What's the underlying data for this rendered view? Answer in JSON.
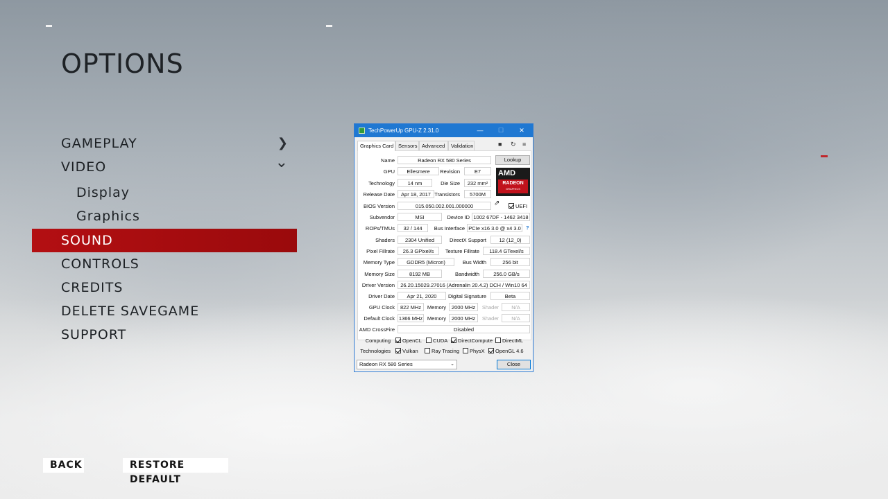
{
  "game": {
    "title": "OPTIONS",
    "menu": [
      {
        "label": "GAMEPLAY",
        "arrow": "❯"
      },
      {
        "label": "VIDEO",
        "arrow": "⌄"
      },
      {
        "label": "Display"
      },
      {
        "label": "Graphics"
      },
      {
        "label": "SOUND"
      },
      {
        "label": "CONTROLS"
      },
      {
        "label": "CREDITS"
      },
      {
        "label": "DELETE SAVEGAME"
      },
      {
        "label": "SUPPORT"
      }
    ],
    "back_label": "BACK",
    "restore_label": "RESTORE DEFAULT",
    "accent_color": "#b30f12"
  },
  "gpuz": {
    "window_title": "TechPowerUp GPU-Z 2.31.0",
    "window_buttons": {
      "minimize": "—",
      "maximize": "☐",
      "close": "✕"
    },
    "tabs": [
      "Graphics Card",
      "Sensors",
      "Advanced",
      "Validation"
    ],
    "tool_icons": {
      "camera": "camera-icon",
      "refresh": "refresh-icon",
      "menu": "menu-icon"
    },
    "lookup_label": "Lookup",
    "logo": {
      "brand": "AMD",
      "line1": "RADEON",
      "line2": "GRAPHICS"
    },
    "fields": {
      "name_label": "Name",
      "name": "Radeon RX 580 Series",
      "gpu_label": "GPU",
      "gpu": "Ellesmere",
      "revision_label": "Revision",
      "revision": "E7",
      "technology_label": "Technology",
      "technology": "14 nm",
      "die_size_label": "Die Size",
      "die_size": "232 mm²",
      "release_date_label": "Release Date",
      "release_date": "Apr 18, 2017",
      "transistors_label": "Transistors",
      "transistors": "5700M",
      "bios_label": "BIOS Version",
      "bios": "015.050.002.001.000000",
      "uefi_label": "UEFI",
      "subvendor_label": "Subvendor",
      "subvendor": "MSI",
      "device_id_label": "Device ID",
      "device_id": "1002 67DF - 1462 3418",
      "rops_label": "ROPs/TMUs",
      "rops": "32 / 144",
      "bus_interface_label": "Bus Interface",
      "bus_interface": "PCIe x16 3.0 @ x4 3.0",
      "help": "?",
      "shaders_label": "Shaders",
      "shaders": "2304 Unified",
      "directx_label": "DirectX Support",
      "directx": "12 (12_0)",
      "pixel_fillrate_label": "Pixel Fillrate",
      "pixel_fillrate": "26.3 GPixel/s",
      "texture_fillrate_label": "Texture Fillrate",
      "texture_fillrate": "118.4 GTexel/s",
      "memory_type_label": "Memory Type",
      "memory_type": "GDDR5 (Micron)",
      "bus_width_label": "Bus Width",
      "bus_width": "256 bit",
      "memory_size_label": "Memory Size",
      "memory_size": "8192 MB",
      "bandwidth_label": "Bandwidth",
      "bandwidth": "256.0 GB/s",
      "driver_version_label": "Driver Version",
      "driver_version": "26.20.15029.27016 (Adrenalin 20.4.2) DCH / Win10 64",
      "driver_date_label": "Driver Date",
      "driver_date": "Apr 21, 2020",
      "digital_signature_label": "Digital Signature",
      "digital_signature": "Beta",
      "gpu_clock_label": "GPU Clock",
      "gpu_clock": "822 MHz",
      "memory_label": "Memory",
      "gpu_clock_memory": "2000 MHz",
      "shader_label": "Shader",
      "na": "N/A",
      "default_clock_label": "Default Clock",
      "default_clock": "1366 MHz",
      "default_clock_memory": "2000 MHz",
      "crossfire_label": "AMD CrossFire",
      "crossfire": "Disabled",
      "computing_label": "Computing",
      "technologies_label": "Technologies"
    },
    "computing": [
      {
        "label": "OpenCL",
        "checked": true
      },
      {
        "label": "CUDA",
        "checked": false
      },
      {
        "label": "DirectCompute",
        "checked": true
      },
      {
        "label": "DirectML",
        "checked": false
      }
    ],
    "technologies": [
      {
        "label": "Vulkan",
        "checked": true
      },
      {
        "label": "Ray Tracing",
        "checked": false
      },
      {
        "label": "PhysX",
        "checked": false
      },
      {
        "label": "OpenGL 4.6",
        "checked": true
      }
    ],
    "selected_gpu": "Radeon RX 580 Series",
    "close_label": "Close",
    "title_color": "#1f78d2"
  }
}
